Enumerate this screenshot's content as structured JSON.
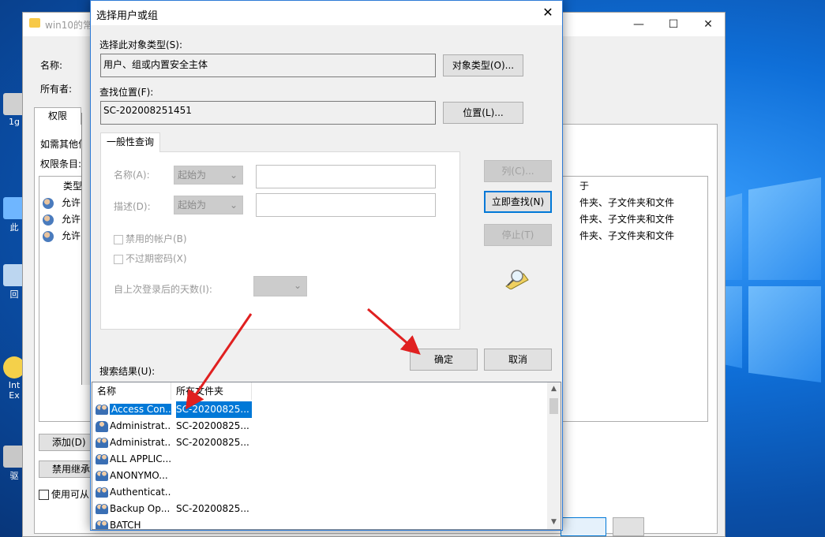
{
  "background_window": {
    "title": "win10的常",
    "name_label": "名称:",
    "owner_label": "所有者:",
    "tab_permissions": "权限",
    "info_text": "如需其他信",
    "entries_label": "权限条目:",
    "type_header": "类型",
    "rows": [
      "允许",
      "允许",
      "允许"
    ],
    "apply_header": "于",
    "apply_texts": [
      "件夹、子文件夹和文件",
      "件夹、子文件夹和文件",
      "件夹、子文件夹和文件"
    ],
    "add_button": "添加(D)",
    "disable_inherit_button": "禁用继承",
    "use_checkbox": "使用可从",
    "minimize": "—",
    "maximize": "☐",
    "close": "✕"
  },
  "desktop": {
    "icon_labels": [
      "1g",
      "此",
      "回",
      "Int\nEx",
      "驱"
    ]
  },
  "dialog": {
    "title": "选择用户或组",
    "close": "✕",
    "object_type_label": "选择此对象类型(S):",
    "object_type_value": "用户、组或内置安全主体",
    "object_type_button": "对象类型(O)...",
    "location_label": "查找位置(F):",
    "location_value": "SC-202008251451",
    "location_button": "位置(L)...",
    "tab_general": "一般性查询",
    "name_label": "名称(A):",
    "name_mode": "起始为",
    "desc_label": "描述(D):",
    "desc_mode": "起始为",
    "disabled_accounts": "禁用的帐户(B)",
    "no_expire_pw": "不过期密码(X)",
    "days_since_login": "自上次登录后的天数(I):",
    "columns_button": "列(C)...",
    "find_now_button": "立即查找(N)",
    "stop_button": "停止(T)",
    "ok_button": "确定",
    "cancel_button": "取消",
    "results_label": "搜索结果(U):",
    "results_headers": [
      "名称",
      "所在文件夹"
    ],
    "results": [
      {
        "name": "Access Con...",
        "folder": "SC-20200825...",
        "icon": "group-icon",
        "selected": true
      },
      {
        "name": "Administrat...",
        "folder": "SC-20200825...",
        "icon": "user-icon",
        "selected": false
      },
      {
        "name": "Administrat...",
        "folder": "SC-20200825...",
        "icon": "group-icon",
        "selected": false
      },
      {
        "name": "ALL APPLIC...",
        "folder": "",
        "icon": "group-icon",
        "selected": false
      },
      {
        "name": "ANONYMO...",
        "folder": "",
        "icon": "group-icon",
        "selected": false
      },
      {
        "name": "Authenticat...",
        "folder": "",
        "icon": "group-icon",
        "selected": false
      },
      {
        "name": "Backup Op...",
        "folder": "SC-20200825...",
        "icon": "group-icon",
        "selected": false
      },
      {
        "name": "BATCH",
        "folder": "",
        "icon": "group-icon",
        "selected": false
      }
    ]
  },
  "colors": {
    "accent": "#0078d7",
    "arrow": "#e02020"
  }
}
